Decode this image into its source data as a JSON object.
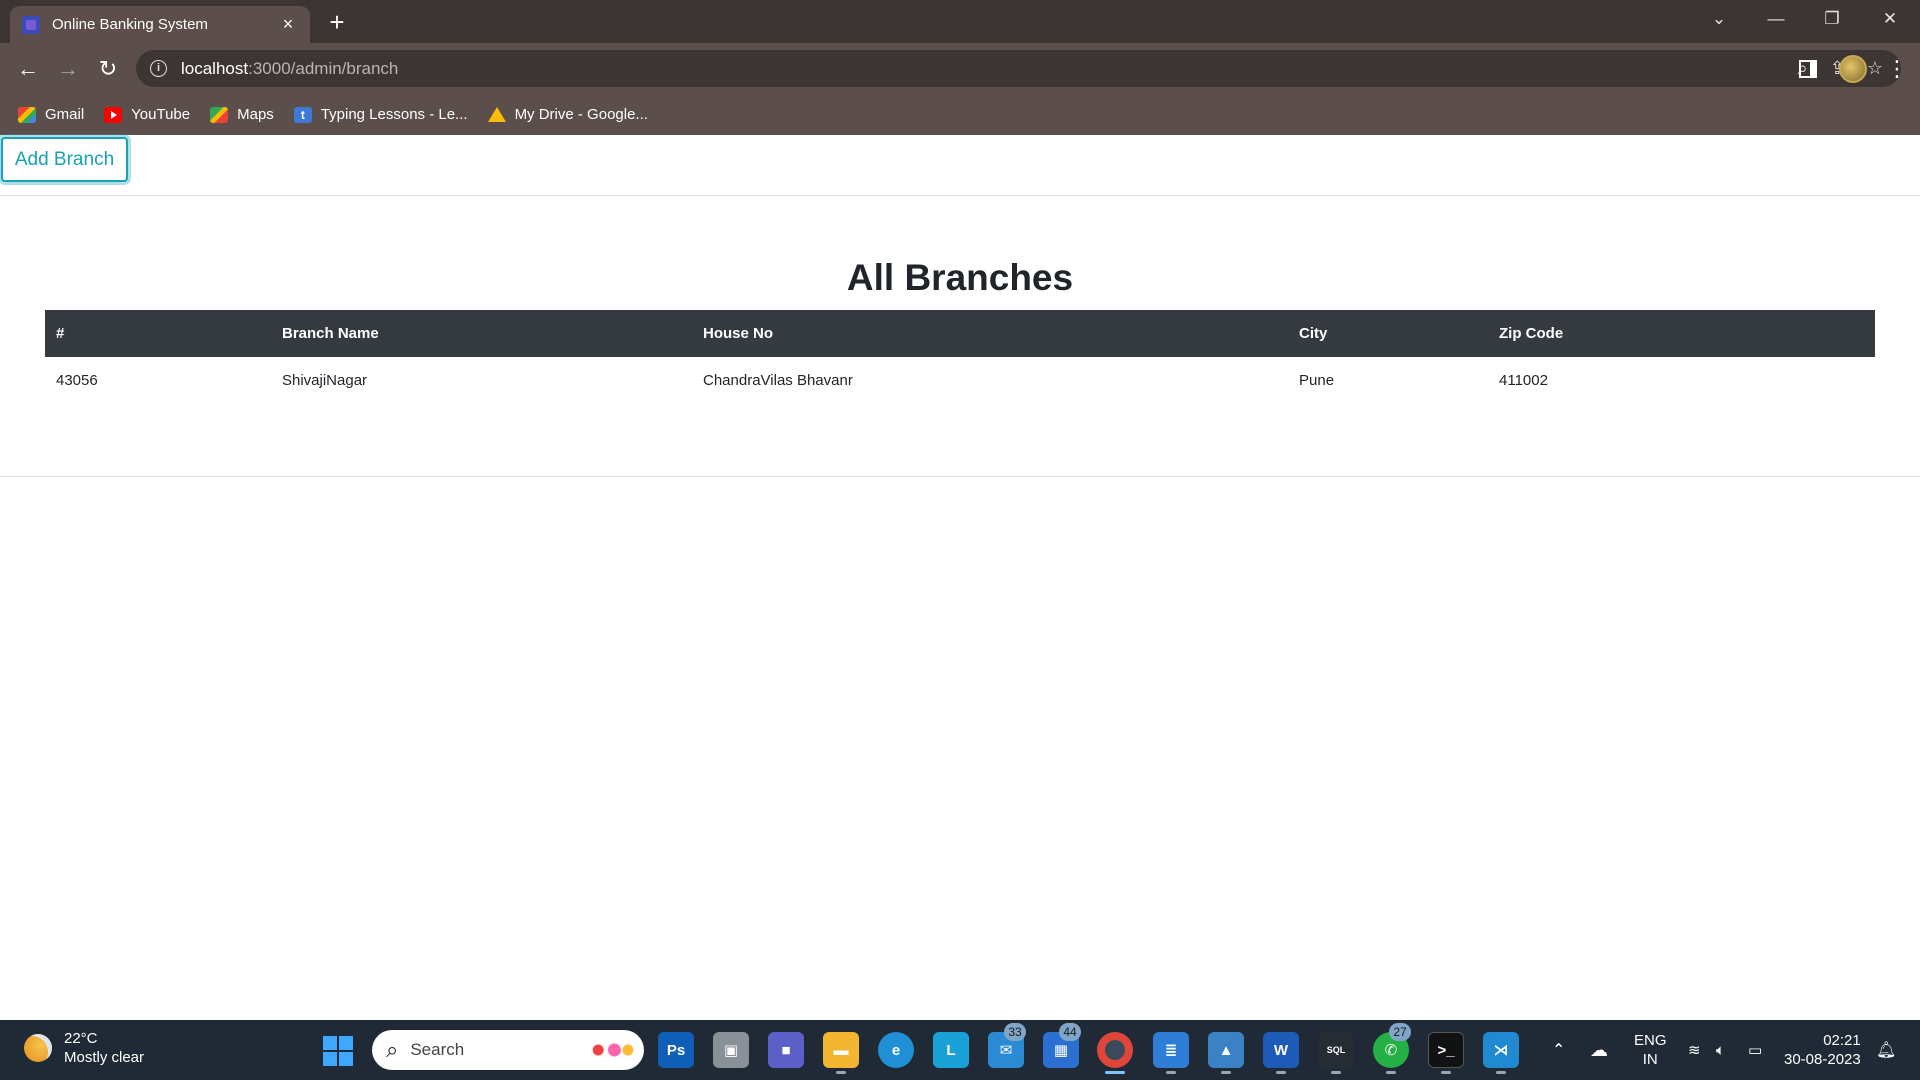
{
  "browser": {
    "tab": {
      "title": "Online Banking System",
      "close": "×"
    },
    "new_tab": "+",
    "url": {
      "host": "localhost",
      "path": ":3000/admin/branch"
    },
    "bookmarks": [
      {
        "label": "Gmail",
        "icon": "gmail-icon"
      },
      {
        "label": "YouTube",
        "icon": "youtube-icon"
      },
      {
        "label": "Maps",
        "icon": "maps-icon"
      },
      {
        "label": "Typing Lessons - Le...",
        "icon": "typing-icon"
      },
      {
        "label": "My Drive - Google...",
        "icon": "google-drive-icon"
      }
    ]
  },
  "page": {
    "add_button": "Add Branch",
    "heading": "All Branches",
    "table": {
      "columns": [
        "#",
        "Branch Name",
        "House No",
        "City",
        "Zip Code"
      ],
      "rows": [
        [
          "43056",
          "ShivajiNagar",
          "ChandraVilas Bhavanr",
          "Pune",
          "411002"
        ]
      ]
    }
  },
  "taskbar": {
    "weather": {
      "temp": "22°C",
      "condition": "Mostly clear"
    },
    "search_placeholder": "Search",
    "badges": {
      "mail": "33",
      "store": "44",
      "whatsapp": "27"
    },
    "lang": {
      "line1": "ENG",
      "line2": "IN"
    },
    "clock": {
      "time": "02:21",
      "date": "30-08-2023"
    }
  },
  "colors": {
    "accent": "#17a2b8",
    "table_header": "#343a40",
    "chrome_frame": "#3c3533",
    "chrome_toolbar": "#5b4e4b",
    "taskbar": "#1f2a36"
  }
}
